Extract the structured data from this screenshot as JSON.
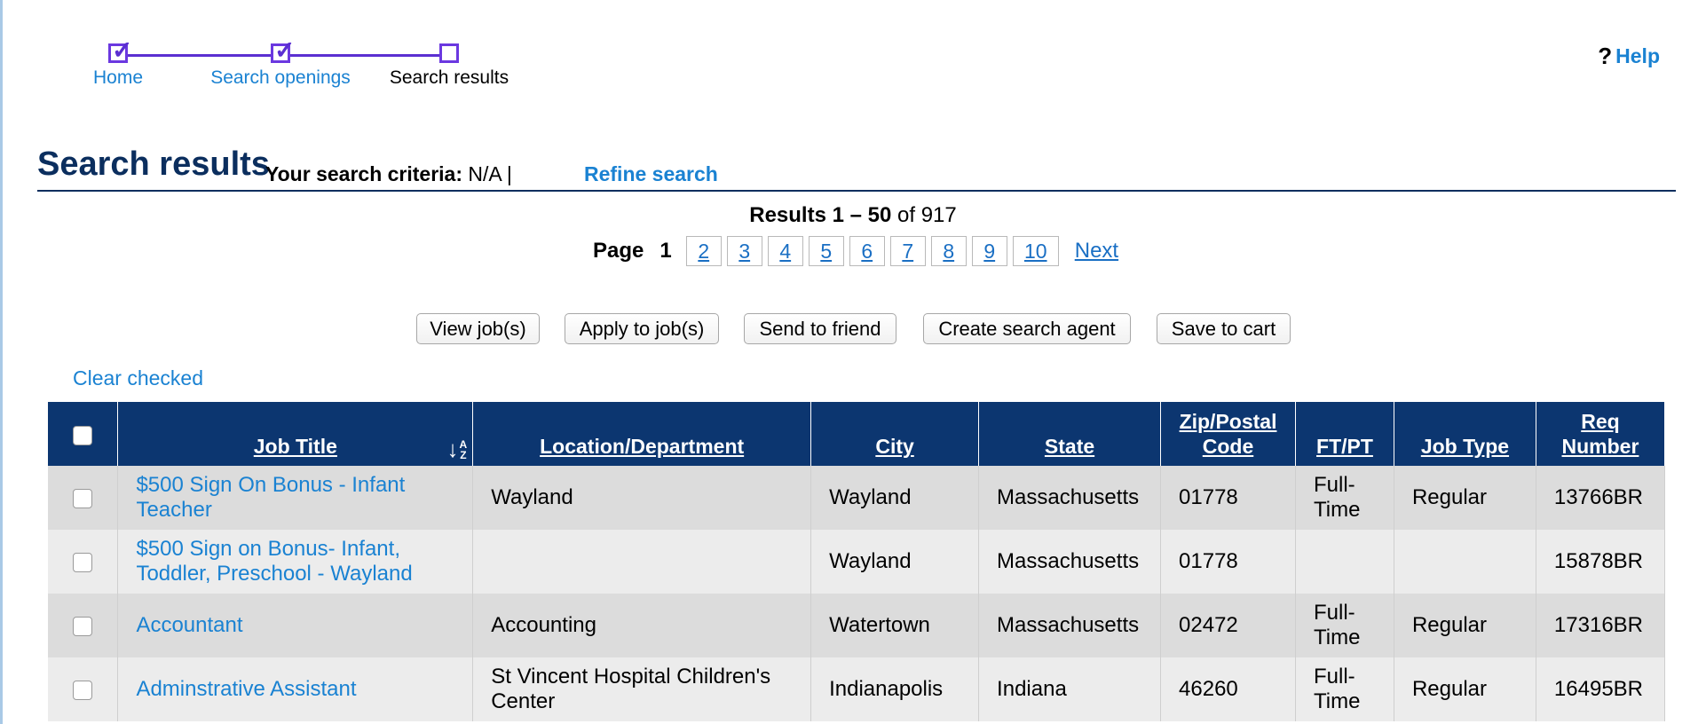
{
  "stepper": {
    "steps": [
      {
        "label": "Home",
        "checked": true,
        "state": "link"
      },
      {
        "label": "Search openings",
        "checked": true,
        "state": "link"
      },
      {
        "label": "Search results",
        "checked": false,
        "state": "current"
      }
    ],
    "check_glyph": "✓",
    "line_color": "#5b2fd1"
  },
  "help": {
    "icon": "question-mark-icon",
    "glyph": "?",
    "label": "Help"
  },
  "header": {
    "title": "Search results",
    "criteria_label": "Your search criteria:",
    "criteria_value": "N/A |",
    "refine_label": "Refine search"
  },
  "results": {
    "prefix": "Results",
    "range": "1 – 50",
    "of_label": "of",
    "total": "917"
  },
  "pagination": {
    "page_label": "Page",
    "current": "1",
    "pages": [
      "2",
      "3",
      "4",
      "5",
      "6",
      "7",
      "8",
      "9",
      "10"
    ],
    "next_label": "Next"
  },
  "actions": {
    "view": "View job(s)",
    "apply": "Apply to job(s)",
    "send": "Send to friend",
    "agent": "Create search agent",
    "save": "Save to cart"
  },
  "clear_checked": "Clear checked",
  "table": {
    "columns": [
      "Job Title",
      "Location/Department",
      "City",
      "State",
      "Zip/Postal Code",
      "FT/PT",
      "Job Type",
      "Req Number"
    ],
    "sort_icon": "sort-az-icon",
    "rows": [
      {
        "title": "$500 Sign On Bonus - Infant Teacher",
        "location": "Wayland",
        "city": "Wayland",
        "state": "Massachusetts",
        "zip": "01778",
        "ftpt": "Full-Time",
        "type": "Regular",
        "req": "13766BR"
      },
      {
        "title": "$500 Sign on Bonus- Infant, Toddler, Preschool - Wayland",
        "location": "",
        "city": "Wayland",
        "state": "Massachusetts",
        "zip": "01778",
        "ftpt": "",
        "type": "",
        "req": "15878BR"
      },
      {
        "title": "Accountant",
        "location": "Accounting",
        "city": "Watertown",
        "state": "Massachusetts",
        "zip": "02472",
        "ftpt": "Full-Time",
        "type": "Regular",
        "req": "17316BR"
      },
      {
        "title": "Adminstrative Assistant",
        "location": "St Vincent Hospital Children's Center",
        "city": "Indianapolis",
        "state": "Indiana",
        "zip": "46260",
        "ftpt": "Full-Time",
        "type": "Regular",
        "req": "16495BR"
      }
    ]
  },
  "colors": {
    "header_navy": "#0b2e5e",
    "table_header": "#0c3670",
    "link_blue": "#1a82d2",
    "row_odd": "#dcdcdc",
    "row_even": "#ececec"
  }
}
